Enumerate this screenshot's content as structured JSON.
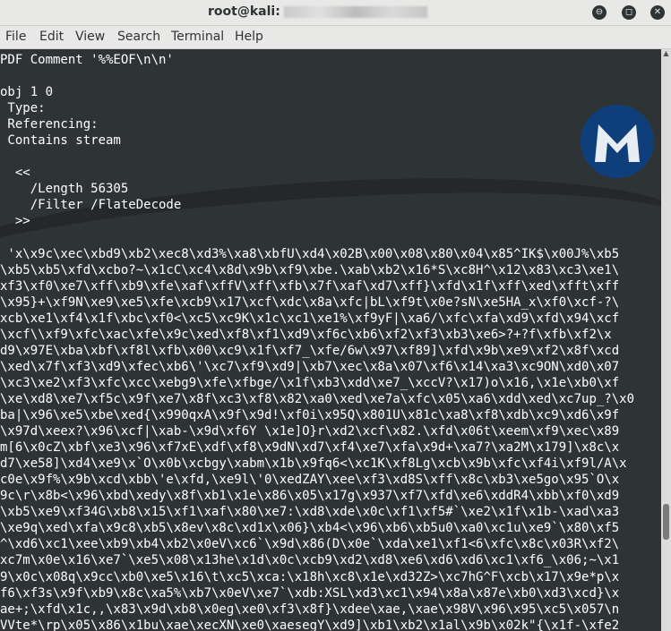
{
  "window": {
    "title": "root@kali:",
    "buttons": {
      "minimize": "⊖",
      "maximize": "◻",
      "close": "✕"
    }
  },
  "menubar": {
    "items": [
      "File",
      "Edit",
      "View",
      "Search",
      "Terminal",
      "Help"
    ]
  },
  "terminal": {
    "lines": [
      "PDF Comment '%%EOF\\n\\n'",
      "",
      "obj 1 0",
      " Type:",
      " Referencing:",
      " Contains stream",
      "",
      "  <<",
      "    /Length 56305",
      "    /Filter /FlateDecode",
      "  >>",
      "",
      " 'x\\x9c\\xec\\xbd9\\xb2\\xec8\\xd3%\\xa8\\xbfU\\xd4\\x02B\\x00\\x08\\x80\\x04\\x85^IK$\\x00J%\\xb5",
      "\\xb5\\xb5\\xfd\\xcbo?~\\x1cC\\xc4\\x8d\\x9b\\xf9\\xbe.\\xab\\xb2\\x16*S\\xc8H^\\x12\\x83\\xc3\\xe1\\",
      "xf3\\xf0\\xe7\\xff\\xb9\\xfe\\xaf\\xffV\\xff\\xfb\\x7f\\xaf\\xd7\\xff}\\xfd\\x1f\\xff\\xed\\xfft\\xff",
      "\\x95}+\\xf9N\\xe9\\xe5\\xfe\\xcb9\\x17\\xcf\\xdc\\x8a\\xfc|bL\\xf9t\\x0e?sN\\xe5HA_x\\xf0\\xcf-?\\",
      "xcb\\xe1\\xf4\\x1f\\xbc\\xf0<\\xc5\\xc9K\\x1c\\xc1\\xe1%\\xf9yF|\\xa6/\\xfc\\xfa\\xd9\\xfd\\x94\\xcf",
      "\\xcf\\\\xf9\\xfc\\xac\\xfe\\x9c\\xed\\xf8\\xf1\\xd9\\xf6c\\xb6\\xf2\\xf3\\xb3\\xe6>?+?f\\xfb\\xf2\\x",
      "d9\\x97E\\xba\\xbf\\xf8l\\xfb\\x00\\xc9\\x1f\\xf7_\\xfe/6w\\x97\\xf89]\\xfd\\x9b\\xe9\\xf2\\x8f\\xcd",
      "\\xed\\x7f\\xf3\\xd9\\xfec\\xb6\\'\\xc7\\xf9\\xd9|\\xb7\\xec\\x8a\\x07\\xf6\\x14\\xa3\\xc9ON\\xd0\\x07",
      "\\xc3\\xe2\\xf3\\xfc\\xcc\\xebg9\\xfe\\xfbge/\\x1f\\xb3\\xdd\\xe7_\\xccV?\\x17)o\\x16,\\x1e\\xb0\\xf",
      "\\xe\\xd8\\xe7\\xf5c\\x9f\\xe7\\x8f\\xc3\\xf8\\x82\\xa0\\xed\\xe7a\\xfc\\x05\\xa6\\xdd\\xed\\xc7up_?\\x0",
      "ba|\\x96\\xe5\\xbe\\xed{\\x990qxA\\x9f\\x9d!\\xf0i\\x95Q\\x801U\\x81c\\xa8\\xf8\\xdb\\xc9\\xd6\\x9f",
      "\\x97d\\xeex?\\x96\\xcf|\\xab-\\x9d\\xf6Y \\x1e]O}r\\xd2\\xcf\\x82.\\xfd\\x06t\\xeem\\xf9\\xec\\x89",
      "m[6\\x0cZ\\xbf\\xe3\\x96\\xf7xE\\xdf\\xf8\\x9dN\\xd7\\xf4\\xe7\\xfa\\x9d+\\xa7?\\xa2M\\x179]\\x8c\\x",
      "d7\\xe58]\\xd4\\xe9\\x`O\\x0b\\xcbgy\\xabm\\x1b\\x9fq6<\\xc1K\\xf8Lg\\xcb\\x9b\\xfc\\xf4i\\xf9l/A\\x",
      "c0e\\x9f%\\x9b\\xcd\\xbb\\'e\\xfd,\\xe9l\\'0\\xedZAY\\xee\\xf3\\xd8S\\xff\\x8c\\xb3\\xe5go\\x95`O\\x",
      "9c\\r\\x8b<\\x96\\xbd\\xedy\\x8f\\xb1\\x1e\\x86\\x05\\x17g\\x937\\xf7\\xfd\\xe6\\xddR4\\xbb\\xf0\\xd9",
      "\\xb5\\xe9\\xf34G\\xb8\\x15\\xf1\\xaf\\x80\\xe7:\\xd8\\xde\\x0c\\xf1\\xf5#`\\xe2\\x1f\\x1b-\\xad\\xa3",
      "\\xe9q\\xed\\xfa\\x9c8\\xb5\\x8ev\\x8c\\xd1x\\x06}\\xb4<\\x96\\xb6\\xb5u0\\xa0\\xc1u\\xe9`\\x80\\xf5",
      "^\\xd6\\xc1\\xee\\xb9\\xb4\\xb2\\x0eV\\xc6`\\x9d\\x86(D\\x0e`\\xda\\xe1\\xf1<6\\xfc\\x8c\\x03R\\xf2\\",
      "xc7m\\x0e\\x16\\xe7`\\xe5\\x08\\x13he\\x1d\\x0c\\xcb9\\xd2\\xd8\\xe6\\xd6\\xd6\\xc1\\xf6_\\x06;~\\x1",
      "9\\x0c\\x08q\\x9cc\\xb0\\xe5\\x16\\t\\xc5\\xca:\\x18h\\xc8\\x1e\\xd32Z>\\xc7hG^F\\xcb\\x17\\x9e*p\\x",
      "f6\\xf3s\\x9f\\xb9\\x8c\\xa5%\\xb7\\x0eV\\xe7`\\xdb:XSL\\xd3\\xc1\\x94\\x8a\\x87e\\xb0\\xd3\\xcd}\\x",
      "ae+;\\xfd\\x1c,,\\x83\\x9d\\xb8\\x0eg\\xe0\\xf3\\x8f}\\xdee\\xae,\\xae\\x98V\\x96\\x95\\xc5\\x057\\n",
      "VVte*\\rp\\x05\\x86\\x1bu\\xae\\xecXN\\xe0\\xaesegY\\xd9]\\xb1\\xb2\\x1al\\x9b\\x02k\"{\\x1f-\\xfe2"
    ]
  }
}
